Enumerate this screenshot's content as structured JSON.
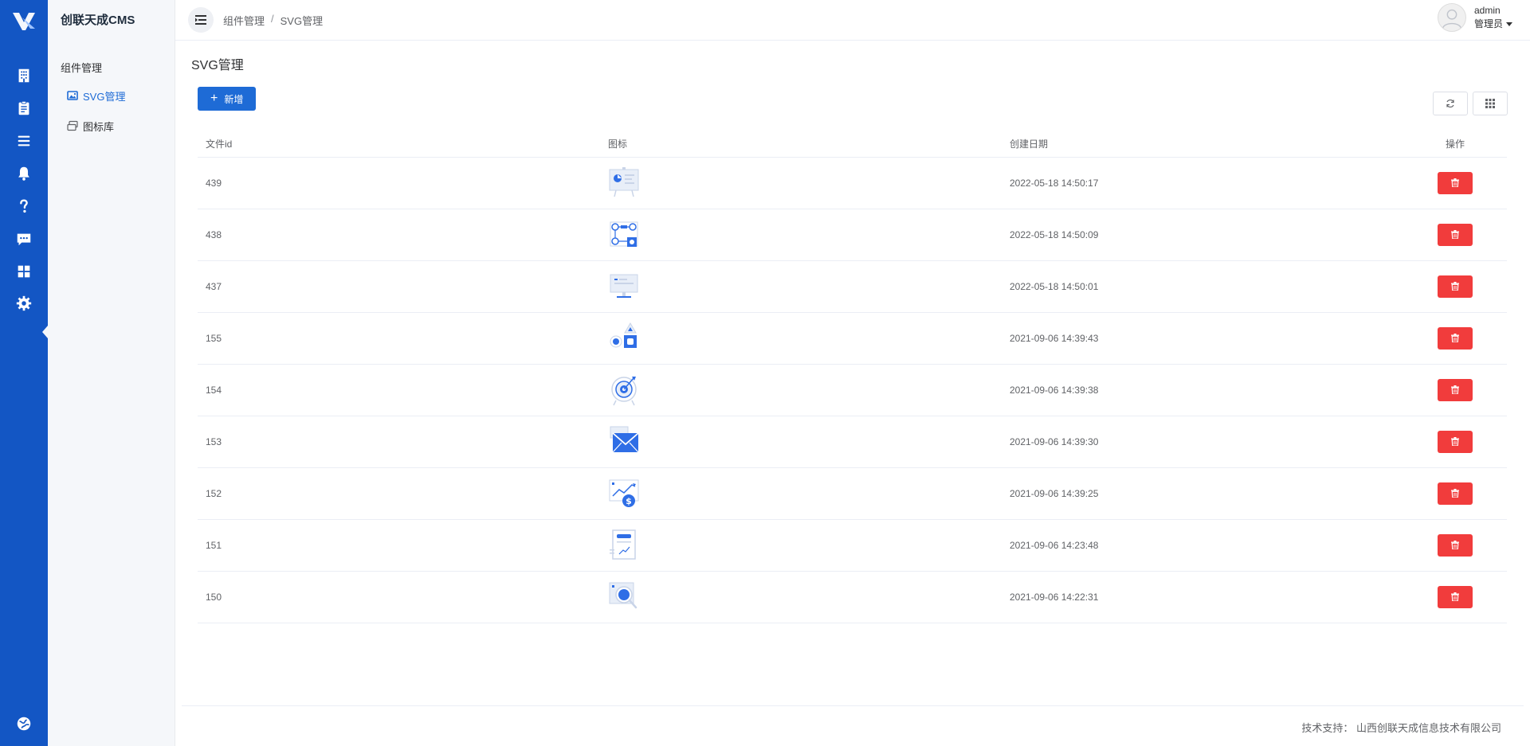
{
  "app": {
    "brand": "创联天成CMS"
  },
  "rail": {
    "icons": [
      "building-icon",
      "clipboard-icon",
      "list-icon",
      "bell-icon",
      "question-icon",
      "chat-icon",
      "grid-icon",
      "gear-icon"
    ],
    "bottom_icon": "globe-icon",
    "active_index": 6
  },
  "sidebar": {
    "group_label": "组件管理",
    "items": [
      {
        "label": "SVG管理",
        "icon": "image-icon",
        "active": true
      },
      {
        "label": "图标库",
        "icon": "stack-icon",
        "active": false
      }
    ]
  },
  "header": {
    "breadcrumb": [
      "组件管理",
      "SVG管理"
    ],
    "breadcrumb_sep": "/",
    "user_name": "admin",
    "user_role": "管理员"
  },
  "main": {
    "title": "SVG管理",
    "add_label": "新增",
    "columns": [
      "文件id",
      "图标",
      "创建日期",
      "操作"
    ],
    "rows": [
      {
        "id": "439",
        "date": "2022-05-18 14:50:17",
        "icon": "presentation-board-icon"
      },
      {
        "id": "438",
        "date": "2022-05-18 14:50:09",
        "icon": "flow-nodes-icon"
      },
      {
        "id": "437",
        "date": "2022-05-18 14:50:01",
        "icon": "monitor-icon"
      },
      {
        "id": "155",
        "date": "2021-09-06 14:39:43",
        "icon": "shapes-icon"
      },
      {
        "id": "154",
        "date": "2021-09-06 14:39:38",
        "icon": "target-icon"
      },
      {
        "id": "153",
        "date": "2021-09-06 14:39:30",
        "icon": "envelope-icon"
      },
      {
        "id": "152",
        "date": "2021-09-06 14:39:25",
        "icon": "growth-chart-icon"
      },
      {
        "id": "151",
        "date": "2021-09-06 14:23:48",
        "icon": "document-chart-icon"
      },
      {
        "id": "150",
        "date": "2021-09-06 14:22:31",
        "icon": "magnifier-icon"
      }
    ]
  },
  "footer": {
    "text": "技术支持：  山西创联天成信息技术有限公司"
  },
  "colors": {
    "rail": "#1356c4",
    "primary": "#1e6bd6",
    "danger": "#f13c3c"
  }
}
